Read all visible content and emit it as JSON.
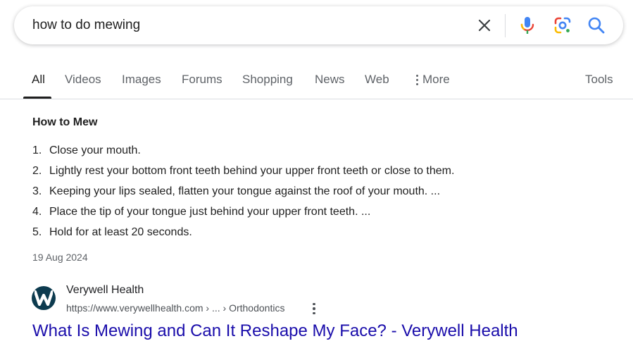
{
  "search": {
    "query": "how to do mewing",
    "icons": [
      "close-icon",
      "microphone-icon",
      "google-lens-icon",
      "search-icon"
    ]
  },
  "tabs": [
    {
      "label": "All",
      "active": true
    },
    {
      "label": "Videos"
    },
    {
      "label": "Images"
    },
    {
      "label": "Forums"
    },
    {
      "label": "Shopping"
    },
    {
      "label": "News"
    },
    {
      "label": "Web"
    },
    {
      "label": "More",
      "icon": "vertical-dots-icon"
    },
    {
      "label": "Tools"
    }
  ],
  "snippet": {
    "title": "How to Mew",
    "steps": [
      {
        "num": "1.",
        "text": "Close your mouth."
      },
      {
        "num": "2.",
        "text": "Lightly rest your bottom front teeth behind your upper front teeth or close to them."
      },
      {
        "num": "3.",
        "text": "Keeping your lips sealed, flatten your tongue against the roof of your mouth. ..."
      },
      {
        "num": "4.",
        "text": "Place the tip of your tongue just behind your upper front teeth. ..."
      },
      {
        "num": "5.",
        "text": "Hold for at least 20 seconds."
      }
    ],
    "date": "19 Aug 2024"
  },
  "result": {
    "site_name": "Verywell Health",
    "url": "https://www.verywellhealth.com › ... › Orthodontics",
    "title": "What Is Mewing and Can It Reshape My Face? - Verywell Health",
    "logo_letter": "W"
  },
  "colors": {
    "link": "#1a0dab",
    "search_blue": "#4285f4",
    "mic_red": "#ea4335",
    "mic_yellow": "#fbbc04",
    "lens_green": "#34a853",
    "logo_bg": "#0d3b4f"
  }
}
